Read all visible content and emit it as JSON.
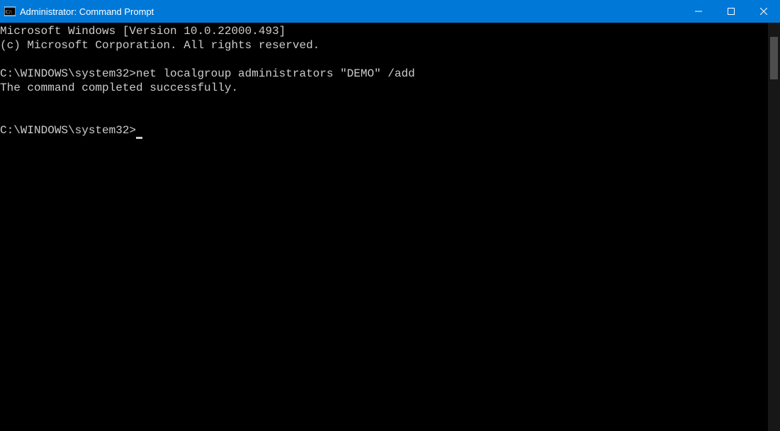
{
  "window": {
    "title": "Administrator: Command Prompt"
  },
  "terminal": {
    "line1": "Microsoft Windows [Version 10.0.22000.493]",
    "line2": "(c) Microsoft Corporation. All rights reserved.",
    "blank1": "",
    "prompt1": "C:\\WINDOWS\\system32>",
    "command1": "net localgroup administrators \"DEMO\" /add",
    "output1": "The command completed successfully.",
    "blank2": "",
    "blank3": "",
    "prompt2": "C:\\WINDOWS\\system32>"
  }
}
